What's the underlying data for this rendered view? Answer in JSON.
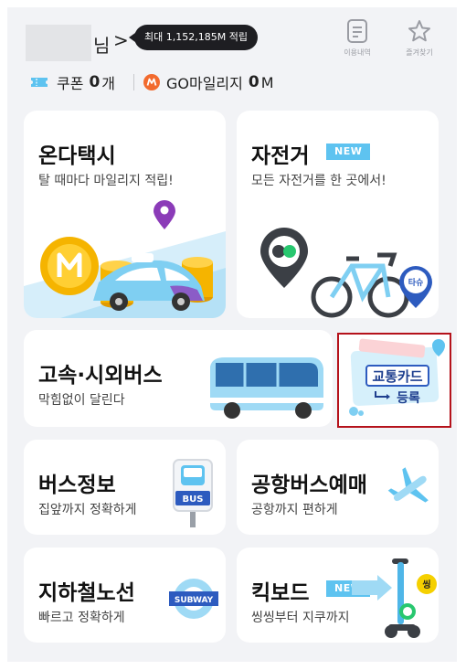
{
  "header": {
    "suffix": "님",
    "chevron": ">",
    "tooltip": "최대 1,152,185M 적립",
    "history_label": "이용내역",
    "favorites_label": "즐겨찾기"
  },
  "points": {
    "coupon_label": "쿠폰",
    "coupon_count": "0",
    "coupon_unit": "개",
    "mileage_label": "GO마일리지",
    "mileage_value": "0",
    "mileage_unit": "M"
  },
  "services": {
    "onda_taxi": {
      "title": "온다택시",
      "subtitle": "탈 때마다 마일리지 적립!"
    },
    "bicycle": {
      "title": "자전거",
      "badge": "NEW",
      "subtitle": "모든 자전거를 한 곳에서!",
      "bike_tag": "타슈"
    },
    "express_bus": {
      "title": "고속·시외버스",
      "subtitle": "막힘없이 달린다"
    },
    "transit_card": {
      "line1": "교통카드",
      "line2": "등록"
    },
    "bus_info": {
      "title": "버스정보",
      "subtitle": "집앞까지 정확하게",
      "sign": "BUS"
    },
    "airport_bus": {
      "title": "공항버스예매",
      "subtitle": "공항까지 편하게"
    },
    "subway": {
      "title": "지하철노선",
      "subtitle": "빠르고 정확하게",
      "sign": "SUBWAY"
    },
    "kickboard": {
      "title": "킥보드",
      "badge": "NEW",
      "subtitle": "씽씽부터 지쿠까지",
      "tag": "씽"
    }
  },
  "colors": {
    "accent_blue": "#5ec3f0",
    "coin_gold": "#f5b400",
    "mileage_orange": "#f26a2e",
    "highlight_red": "#b5121b",
    "background": "#f2f3f6"
  },
  "icons": [
    "list-icon",
    "star-icon",
    "ticket-icon",
    "mileage-icon"
  ]
}
